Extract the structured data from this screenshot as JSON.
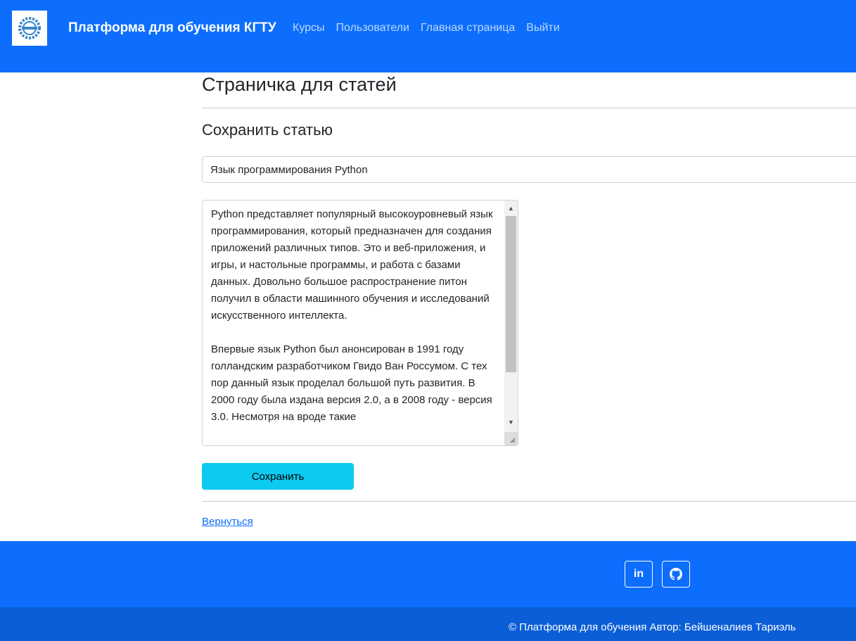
{
  "header": {
    "brand": "Платформа для обучения КГТУ",
    "logo_icon": "university-gear-logo-icon",
    "nav": [
      {
        "label": "Курсы"
      },
      {
        "label": "Пользователи"
      },
      {
        "label": "Главная страница"
      },
      {
        "label": "Выйти"
      }
    ]
  },
  "main": {
    "page_title": "Страничка для статей",
    "section_title": "Сохранить статью",
    "title_input_value": "Язык программирования Python",
    "content_paragraphs": [
      "Python представляет популярный высокоуровневый язык программирования, который предназначен для создания приложений различных типов. Это и веб-приложения, и игры, и настольные программы, и работа с базами данных. Довольно большое распространение питон получил в области машинного обучения и исследований искусственного интеллекта.",
      "Впервые язык Python был анонсирован в 1991 году голландским разработчиком Гвидо Ван Россумом. С тех пор данный язык проделал большой путь развития. В 2000 году была издана версия 2.0, а в 2008 году - версия 3.0. Несмотря на вроде такие"
    ],
    "save_label": "Сохранить",
    "back_label": "Вернуться"
  },
  "footer": {
    "social": [
      {
        "icon": "linkedin-icon",
        "glyph": "in"
      },
      {
        "icon": "github-icon"
      }
    ],
    "copyright": "© Платформа для обучения Автор: Бейшеналиев Тариэль"
  },
  "colors": {
    "primary": "#0d6efd",
    "primary_dark": "#0b5ed7",
    "info_button": "#0dcaf0"
  }
}
